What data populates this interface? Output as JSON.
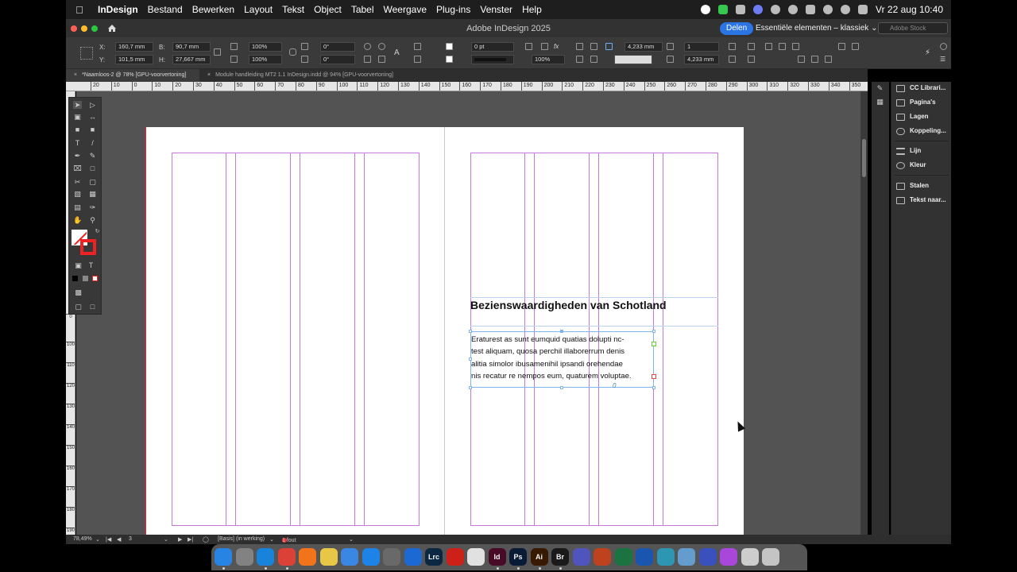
{
  "menubar": {
    "app": "InDesign",
    "items": [
      "Bestand",
      "Bewerken",
      "Layout",
      "Tekst",
      "Object",
      "Tabel",
      "Weergave",
      "Plug-ins",
      "Venster",
      "Help"
    ],
    "clock": "Vr 22 aug  10:40"
  },
  "titlebar": {
    "title": "Adobe InDesign 2025",
    "share_label": "Delen",
    "workspace": "Essentiële elementen – klassiek",
    "search_placeholder": "Adobe Stock"
  },
  "control": {
    "x_label": "X:",
    "x_value": "160,7 mm",
    "y_label": "Y:",
    "y_value": "101,5 mm",
    "w_label": "B:",
    "w_value": "90,7 mm",
    "h_label": "H:",
    "h_value": "27,667 mm",
    "scale_x": "100%",
    "scale_y": "100%",
    "rotate": "0°",
    "shear": "0°",
    "stroke_weight": "0 pt",
    "opacity": "100%",
    "gap1": "4,233 mm",
    "gap2": "4,233 mm",
    "columns": "1"
  },
  "tabs": [
    {
      "label": "*Naamloos-2 @ 78% [GPU-voorvertoning]",
      "close": "×"
    },
    {
      "label": "Module handleiding MT2 1.1 InDesign.indd @ 94% [GPU-voorvertoning]",
      "close": "×"
    }
  ],
  "hruler_ticks": [
    "20",
    "10",
    "0",
    "10",
    "20",
    "30",
    "40",
    "50",
    "60",
    "70",
    "80",
    "90",
    "100",
    "110",
    "120",
    "130",
    "140",
    "150",
    "160",
    "170",
    "180",
    "190",
    "200",
    "210",
    "220",
    "230",
    "240",
    "250",
    "260",
    "270",
    "280",
    "290",
    "300",
    "310",
    "320",
    "330",
    "340",
    "350"
  ],
  "vruler_ticks": [
    "0",
    "100",
    "110",
    "120",
    "130",
    "140",
    "150",
    "160",
    "170",
    "180",
    "190"
  ],
  "document": {
    "heading": "Bezienswaardigheden van Schotland",
    "body_lines": [
      "Eraturest as sunt eumquid quatias dolupti nc-",
      "test aliquam, quosa perchil illaborerrum denis",
      "alitia simolor ibusamenihil ipsandi orehendae",
      "nis recatur re nempos eum, quaturem voluptae."
    ],
    "anchor_glyph": "0"
  },
  "panels": [
    {
      "label": "CC Librari..."
    },
    {
      "label": "Pagina's"
    },
    {
      "label": "Lagen"
    },
    {
      "label": "Koppeling..."
    },
    {
      "label": "Lijn"
    },
    {
      "label": "Kleur"
    },
    {
      "label": "Stalen"
    },
    {
      "label": "Tekst naar..."
    }
  ],
  "status": {
    "zoom": "78,49%",
    "page": "3",
    "style": "[Basis] (in werking)",
    "errors": "1 fout"
  },
  "dock": {
    "apps": [
      {
        "name": "finder-icon",
        "label": "",
        "color": "#2a8cf0"
      },
      {
        "name": "launchpad-icon",
        "label": "",
        "color": "#8a8a8a"
      },
      {
        "name": "safari-icon",
        "label": "",
        "color": "#1a8be6"
      },
      {
        "name": "chrome-icon",
        "label": "",
        "color": "#e8453c"
      },
      {
        "name": "firefox-icon",
        "label": "",
        "color": "#ff7b1c"
      },
      {
        "name": "notes-icon",
        "label": "",
        "color": "#f6d24a"
      },
      {
        "name": "files-icon",
        "label": "",
        "color": "#3d8ef0"
      },
      {
        "name": "appstore-icon",
        "label": "",
        "color": "#1f8bf3"
      },
      {
        "name": "settings-icon",
        "label": "",
        "color": "#6f6f6f"
      },
      {
        "name": "vpn-icon",
        "label": "",
        "color": "#1f6fe0"
      },
      {
        "name": "lightroom-classic-icon",
        "label": "Lrc",
        "color": "#0c2a45"
      },
      {
        "name": "acrobat-icon",
        "label": "",
        "color": "#d8221a"
      },
      {
        "name": "pages-icon",
        "label": "",
        "color": "#eeeeee"
      },
      {
        "name": "indesign-icon",
        "label": "Id",
        "color": "#4b0b2a"
      },
      {
        "name": "photoshop-icon",
        "label": "Ps",
        "color": "#0a1c3a"
      },
      {
        "name": "illustrator-icon",
        "label": "Ai",
        "color": "#3a1c02"
      },
      {
        "name": "bridge-icon",
        "label": "Br",
        "color": "#1c1c1c"
      },
      {
        "name": "teams-icon",
        "label": "",
        "color": "#5559c8"
      },
      {
        "name": "powerpoint-icon",
        "label": "",
        "color": "#c8461f"
      },
      {
        "name": "excel-icon",
        "label": "",
        "color": "#1d7a45"
      },
      {
        "name": "word-icon",
        "label": "",
        "color": "#1c5bb9"
      },
      {
        "name": "browser-icon",
        "label": "",
        "color": "#2f9fbd"
      },
      {
        "name": "preview-icon",
        "label": "",
        "color": "#6aa5d8"
      },
      {
        "name": "sphere-icon",
        "label": "",
        "color": "#3d55c8"
      },
      {
        "name": "siri-icon",
        "label": "",
        "color": "#b24be6"
      },
      {
        "name": "document-icon",
        "label": "",
        "color": "#d8d8d8"
      },
      {
        "name": "trash-icon",
        "label": "",
        "color": "#cfcfcf"
      }
    ]
  }
}
